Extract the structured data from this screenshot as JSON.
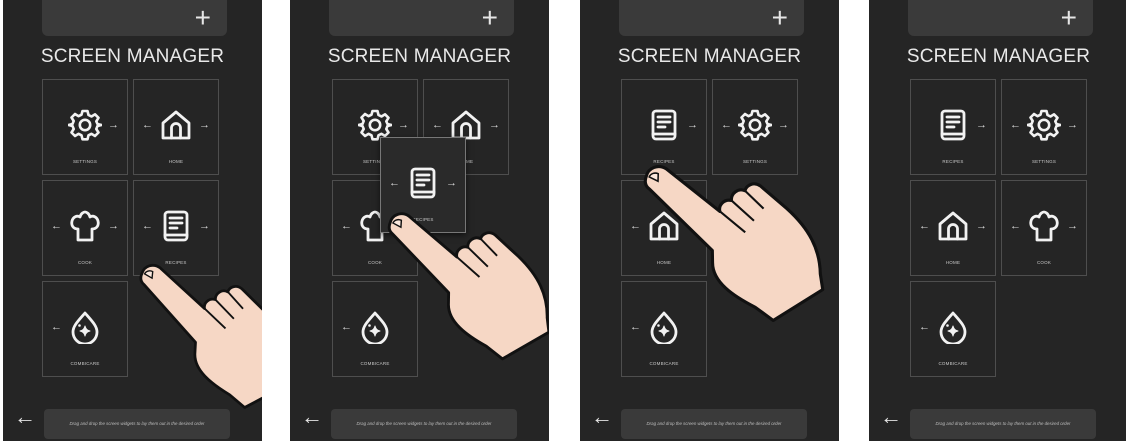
{
  "header": {
    "add_label": "+",
    "title": "SCREEN MANAGER"
  },
  "footer": {
    "back_label": "←",
    "hint": "Drag and drop the screen widgets to lay them out in the desired order"
  },
  "tiles": {
    "settings": "SETTINGS",
    "home": "HOME",
    "cook": "COOK",
    "recipes": "RECIPES",
    "combicare": "COMBICARE"
  },
  "arrows": {
    "left": "←",
    "right": "→"
  },
  "colors": {
    "background": "#252525",
    "panel": "#3a3a3a",
    "tile_border": "#4e4e4e",
    "icon": "#f2f2f2",
    "hand": "#f6d7c5"
  },
  "screens": [
    {
      "step": 1,
      "order": [
        "SETTINGS",
        "HOME",
        "COOK",
        "RECIPES",
        "COMBICARE"
      ]
    },
    {
      "step": 2,
      "order": [
        "SETTINGS",
        "HOME",
        "COOK",
        "RECIPES",
        "COMBICARE"
      ],
      "dragging": "RECIPES"
    },
    {
      "step": 3,
      "order": [
        "RECIPES",
        "SETTINGS",
        "HOME",
        "COOK",
        "COMBICARE"
      ]
    },
    {
      "step": 4,
      "order": [
        "RECIPES",
        "SETTINGS",
        "HOME",
        "COOK",
        "COMBICARE"
      ]
    }
  ]
}
